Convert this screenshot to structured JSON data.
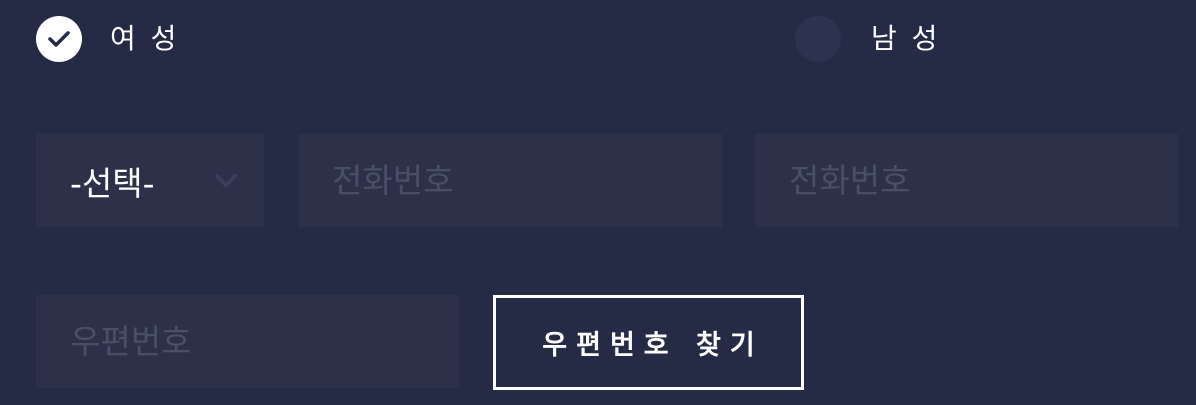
{
  "gender": {
    "female": {
      "label": "여 성",
      "checked": true
    },
    "male": {
      "label": "남 성",
      "checked": false
    }
  },
  "phone": {
    "prefix_select": {
      "value": "-선택-"
    },
    "middle": {
      "placeholder": "전화번호",
      "value": ""
    },
    "last": {
      "placeholder": "전화번호",
      "value": ""
    }
  },
  "postal": {
    "code": {
      "placeholder": "우편번호",
      "value": ""
    },
    "search_button": "우편번호 찾기"
  },
  "colors": {
    "background": "#252a45",
    "field": "#2c3049",
    "placeholder": "#4a4f68",
    "text": "#ffffff"
  },
  "icons": {
    "checked": "check-icon",
    "dropdown": "chevron-down-icon"
  }
}
